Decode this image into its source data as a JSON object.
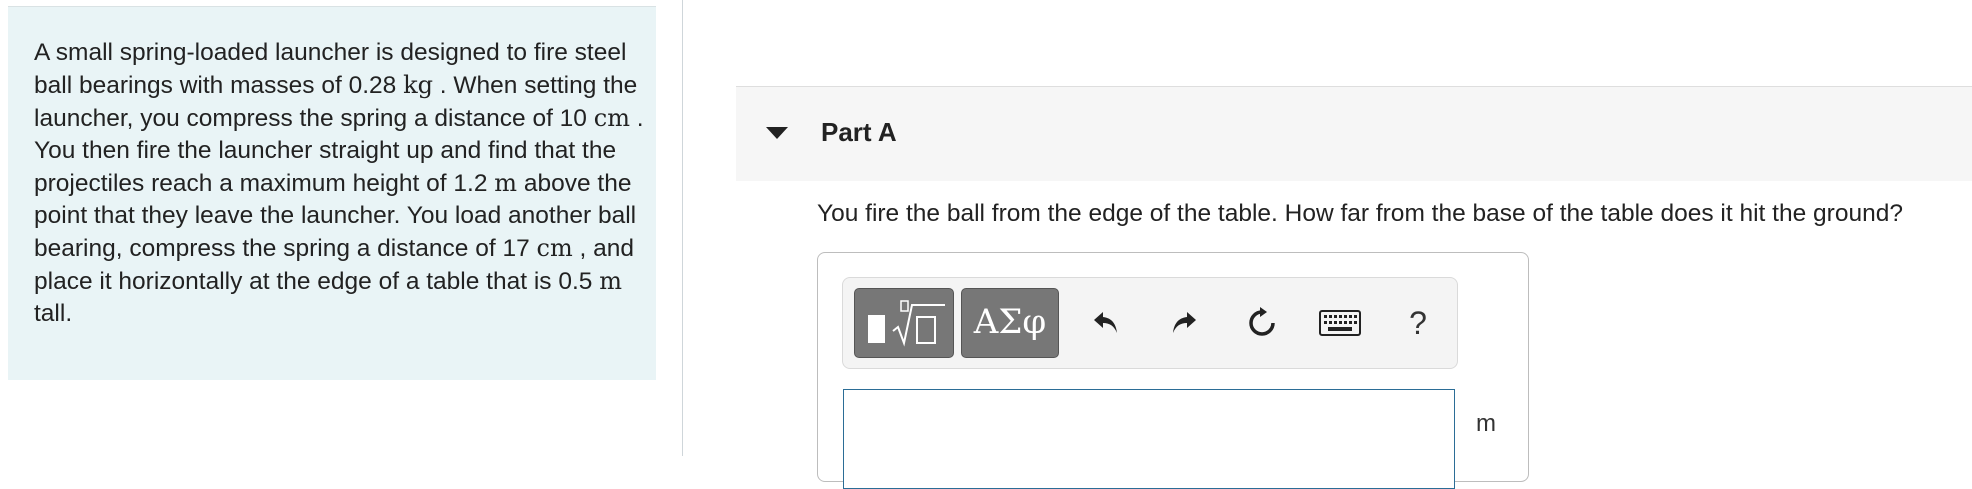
{
  "problem": {
    "t1": "A small spring-loaded launcher is designed to fire steel ball bearings with masses of 0.28 ",
    "u1": "kg",
    "t2": " .  When setting the launcher, you compress the spring a distance of 10 ",
    "u2": "cm",
    "t3": " .  You then fire the launcher straight up and find that the projectiles reach a maximum height of 1.2 ",
    "u3": "m",
    "t4": " above the point that they leave the launcher.  You load another ball bearing, compress the spring a distance of 17 ",
    "u4": "cm",
    "t5": " , and place it horizontally at the edge of a table that is 0.5 ",
    "u5": "m",
    "t6": " tall."
  },
  "part": {
    "title": "Part A"
  },
  "question": "You fire the ball from the edge of the table.  How far from the base of the table does it hit the ground?",
  "toolbar": {
    "symbols_label": "ΑΣφ",
    "help_label": "?",
    "icons": [
      "templates-icon",
      "undo-icon",
      "redo-icon",
      "reset-icon",
      "keyboard-icon",
      "help-icon"
    ]
  },
  "answer": {
    "value": "",
    "unit": "m"
  }
}
